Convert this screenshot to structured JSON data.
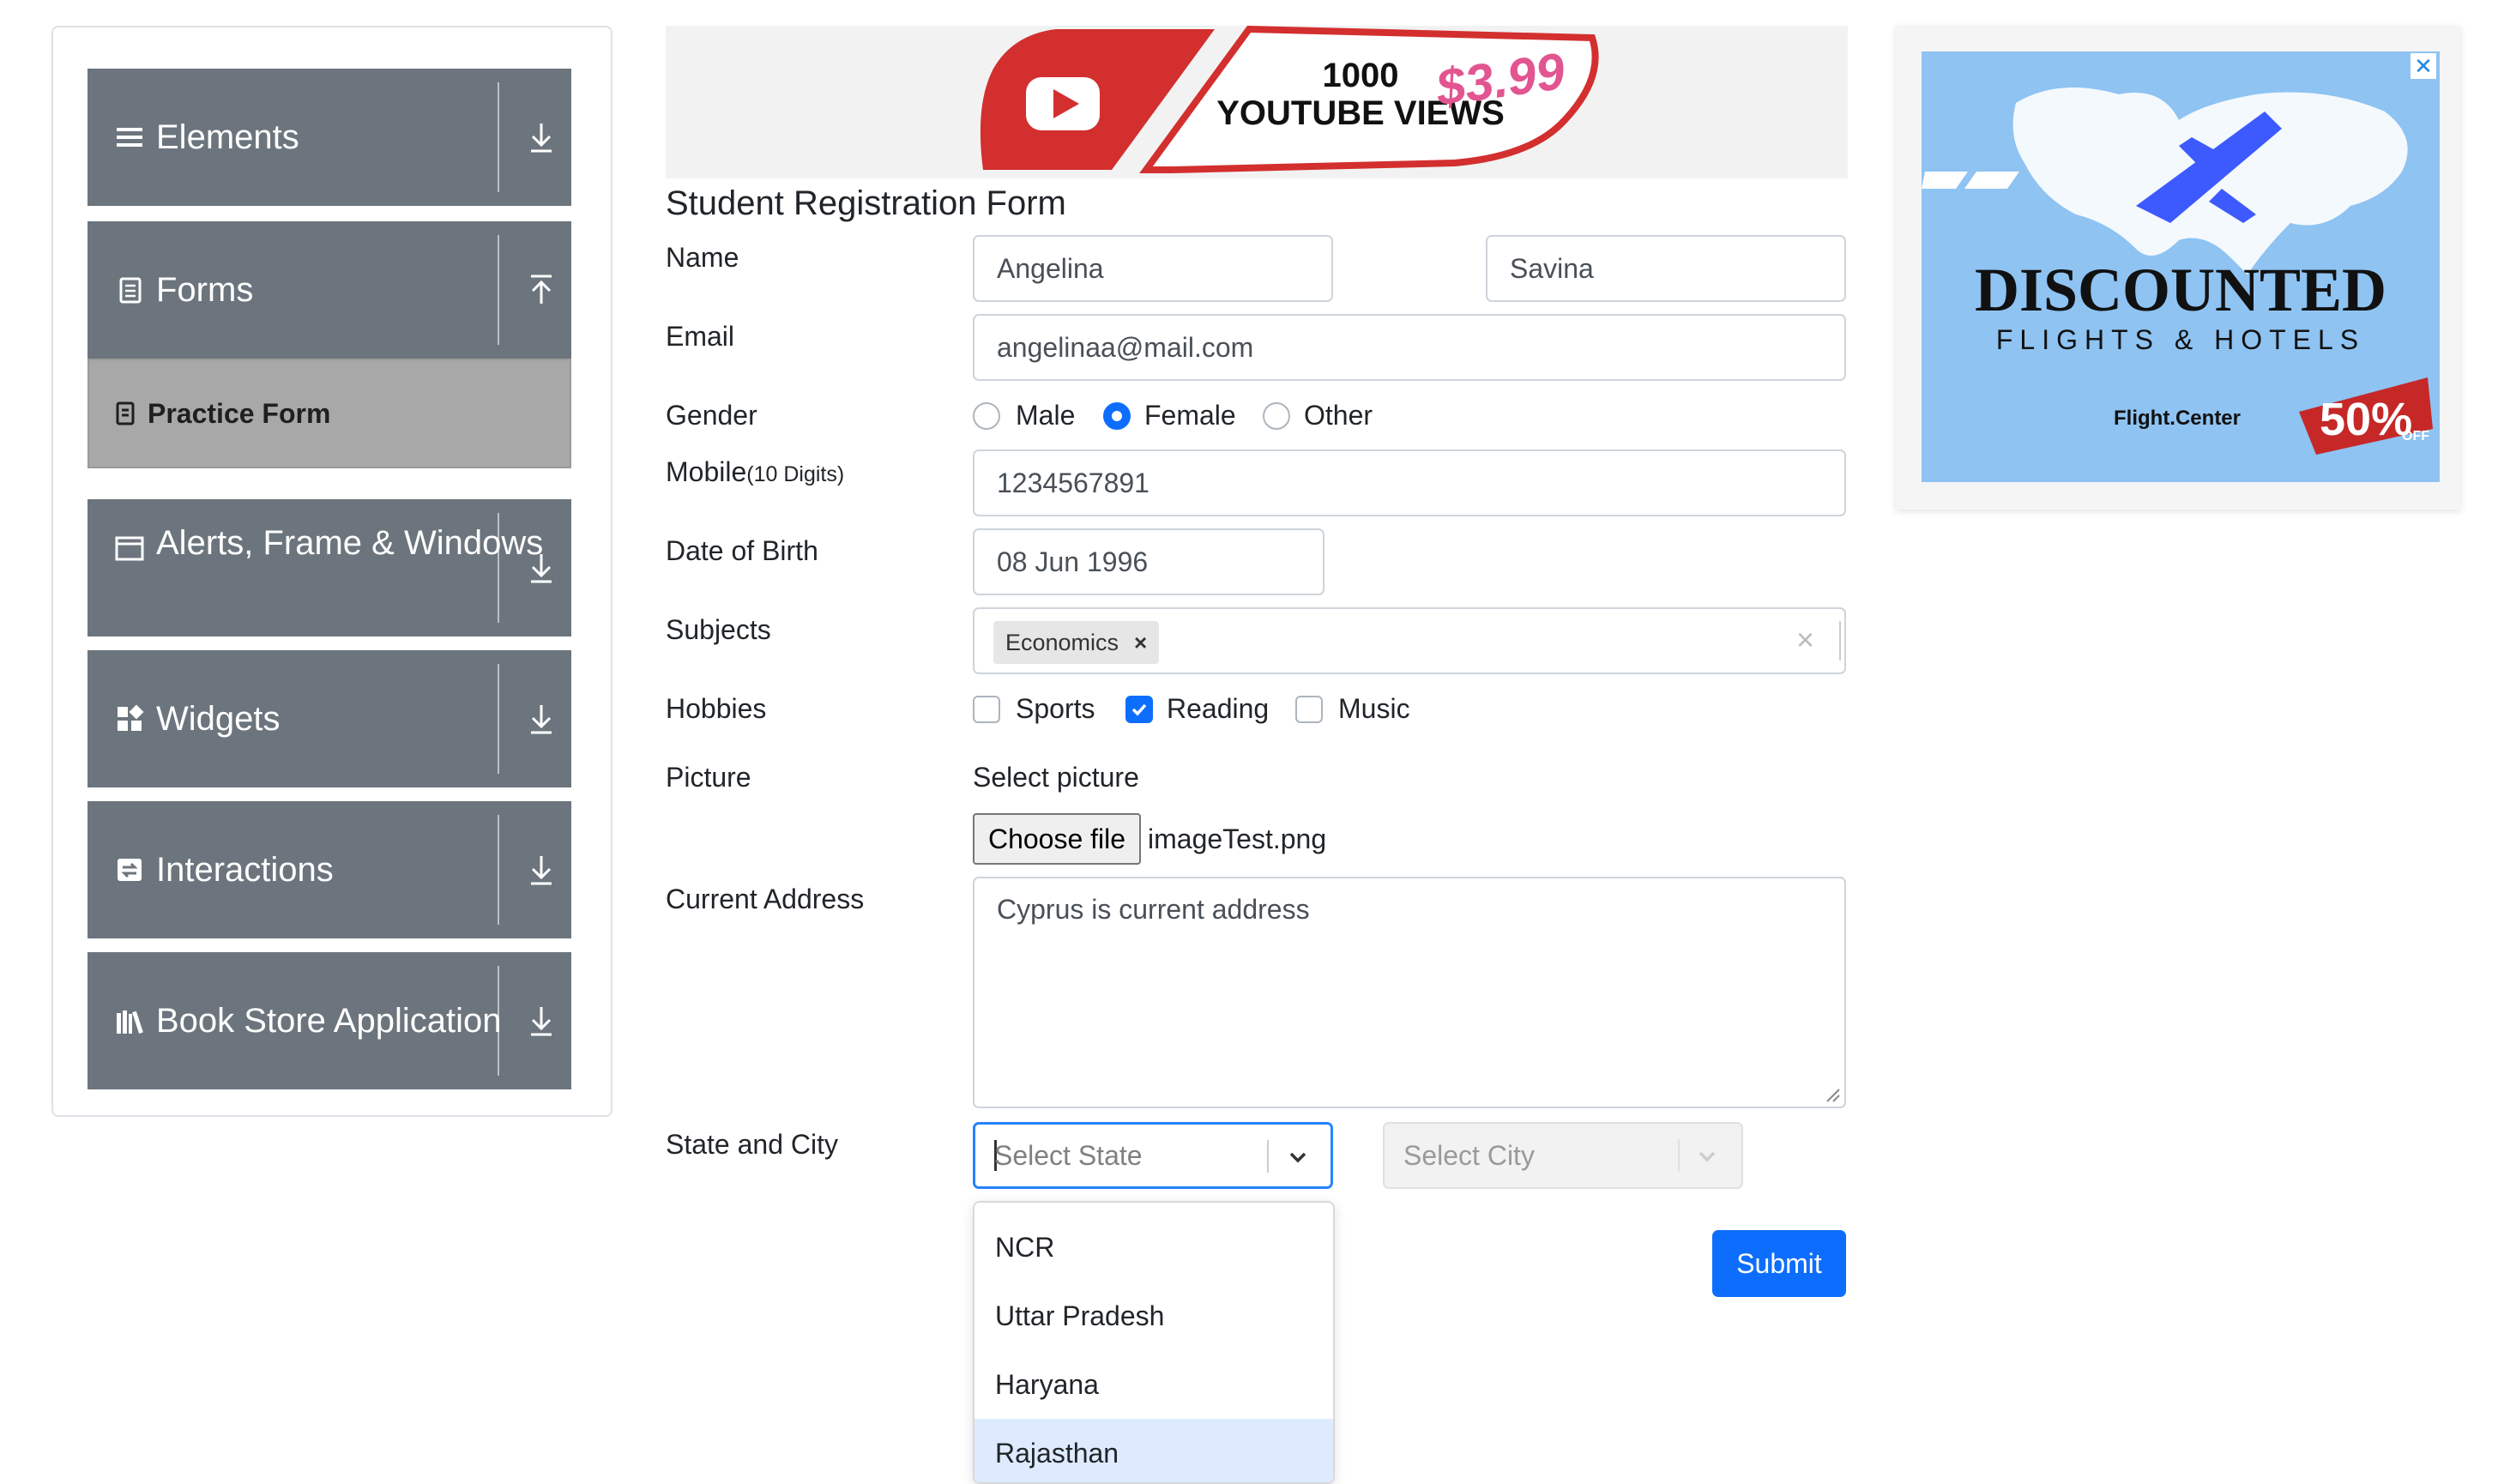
{
  "sidebar": {
    "groups": [
      {
        "label": "Elements",
        "icon": "hamburger-icon",
        "arrow": "download-arrow-icon"
      },
      {
        "label": "Forms",
        "icon": "document-icon",
        "arrow": "upload-arrow-icon"
      },
      {
        "label": "Alerts, Frame & Windows",
        "icon": "window-icon",
        "arrow": "download-arrow-icon"
      },
      {
        "label": "Widgets",
        "icon": "widgets-icon",
        "arrow": "download-arrow-icon"
      },
      {
        "label": "Interactions",
        "icon": "interactions-icon",
        "arrow": "download-arrow-icon"
      },
      {
        "label": "Book Store Application",
        "icon": "books-icon",
        "arrow": "download-arrow-icon"
      }
    ],
    "active_item": {
      "label": "Practice Form",
      "icon": "practice-form-icon"
    }
  },
  "banner": {
    "line1": "1000",
    "line2": "YOUTUBE VIEWS",
    "price": "$3.99"
  },
  "form": {
    "title": "Student Registration Form",
    "name_label": "Name",
    "first_name": "Angelina",
    "last_name": "Savina",
    "email_label": "Email",
    "email": "angelinaa@mail.com",
    "gender_label": "Gender",
    "gender_options": [
      "Male",
      "Female",
      "Other"
    ],
    "gender_selected": "Female",
    "mobile_label": "Mobile",
    "mobile_hint": "(10 Digits)",
    "mobile": "1234567891",
    "dob_label": "Date of Birth",
    "dob": "08 Jun 1996",
    "subjects_label": "Subjects",
    "subject_chip": "Economics",
    "subject_chip_remove": "×",
    "subjects_clear": "×",
    "hobbies_label": "Hobbies",
    "hobbies": [
      "Sports",
      "Reading",
      "Music"
    ],
    "hobbies_checked": [
      "Reading"
    ],
    "picture_label": "Picture",
    "picture_prompt": "Select picture",
    "choose_file": "Choose file",
    "file_name": "imageTest.png",
    "address_label": "Current Address",
    "address": "Cyprus is current address",
    "state_city_label": "State and City",
    "state_placeholder": "Select State",
    "city_placeholder": "Select City",
    "state_options": [
      "NCR",
      "Uttar Pradesh",
      "Haryana",
      "Rajasthan"
    ],
    "state_highlighted": "Rajasthan",
    "submit": "Submit"
  },
  "ad": {
    "close": "✕",
    "headline": "DISCOUNTED",
    "subline": "FLIGHTS & HOTELS",
    "brand": "Flight.Center",
    "discount": "50%",
    "discount_suffix": "OFF"
  },
  "colors": {
    "sidebar_header": "#6c757d",
    "active_item": "#a8a8a8",
    "primary": "#0d6efd",
    "ad_background": "#8ec3f2",
    "banner_red": "#d32f2f"
  }
}
